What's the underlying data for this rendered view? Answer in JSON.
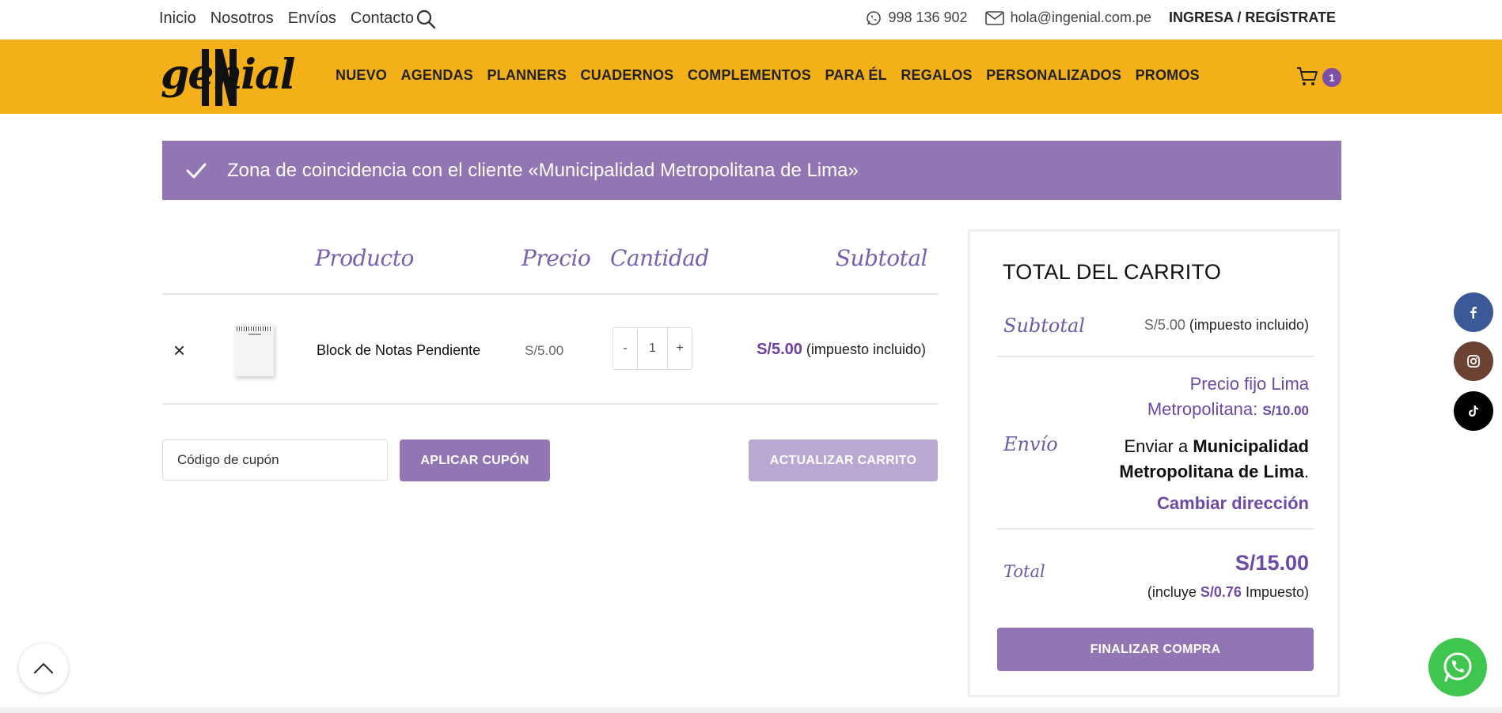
{
  "topbar": {
    "links": [
      "Inicio",
      "Nosotros",
      "Envíos",
      "Contacto"
    ],
    "phone": "998 136 902",
    "email": "hola@ingenial.com.pe",
    "login": "INGRESA / REGÍSTRATE"
  },
  "header": {
    "logo_text": "genial",
    "nav": [
      "NUEVO",
      "AGENDAS",
      "PLANNERS",
      "CUADERNOS",
      "COMPLEMENTOS",
      "PARA ÉL",
      "REGALOS",
      "PERSONALIZADOS",
      "PROMOS"
    ],
    "cart_count": "1",
    "brand_color": "#f3b018",
    "accent_color": "#9176b3"
  },
  "notice": {
    "message": "Zona de coincidencia con el cliente «Municipalidad Metropolitana de Lima»"
  },
  "cart": {
    "headers": {
      "product": "Producto",
      "price": "Precio",
      "quantity": "Cantidad",
      "subtotal": "Subtotal"
    },
    "items": [
      {
        "remove": "×",
        "name": "Block de Notas Pendiente",
        "price": "S/5.00",
        "qty": "1",
        "qty_minus": "-",
        "qty_plus": "+",
        "subtotal": "S/5.00",
        "subtotal_note": "(impuesto incluido)"
      }
    ],
    "coupon_placeholder": "Código de cupón",
    "apply_coupon": "APLICAR CUPÓN",
    "update_cart": "ACTUALIZAR CARRITO"
  },
  "totals": {
    "title": "TOTAL DEL CARRITO",
    "subtotal_label": "Subtotal",
    "subtotal_value": "S/5.00",
    "subtotal_note": "(impuesto incluido)",
    "shipping_label": "Envío",
    "shipping_method_line1": "Precio fijo Lima",
    "shipping_method_line2": "Metropolitana:",
    "shipping_price": "S/10.00",
    "ship_to_prefix": "Enviar a",
    "ship_to_place_line1": "Municipalidad",
    "ship_to_place_line2": "Metropolitana de Lima",
    "change_address": "Cambiar dirección",
    "total_label": "Total",
    "total_value": "S/15.00",
    "tax_prefix": "(incluye",
    "tax_value": "S/0.76",
    "tax_suffix": "Impuesto)",
    "checkout": "FINALIZAR COMPRA"
  },
  "floating": {
    "social": [
      "facebook-icon",
      "instagram-icon",
      "tiktok-icon"
    ],
    "social_colors": [
      "#3b5998",
      "#6b4232",
      "#000000"
    ],
    "whatsapp_color": "#3ec64e"
  }
}
